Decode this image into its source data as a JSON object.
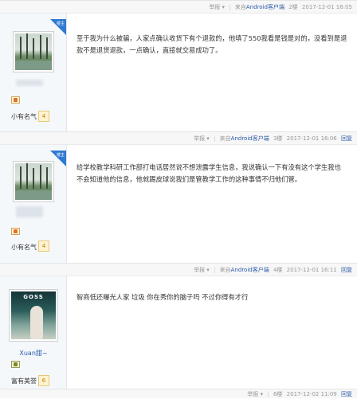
{
  "posts": [
    {
      "meta": {
        "report": "举报",
        "client_prefix": "来自",
        "client_link": "Android客户端",
        "floor": "2楼",
        "time": "2017-12-01 16:05",
        "reply": ""
      },
      "username": "",
      "level_label": "小有名气",
      "level": "4",
      "corner_text": "楼主",
      "avatar": "tree-photo",
      "content": "至于我为什么被骗，人家点确认收货下有个退款的，他填了550我看是钱是对的，没看到是退款不是退货退款，一点确认，直接就交易成功了。"
    },
    {
      "meta": {
        "report": "举报",
        "client_prefix": "来自",
        "client_link": "Android客户端",
        "floor": "3楼",
        "time": "2017-12-01 16:06",
        "reply": "回复"
      },
      "username": "",
      "level_label": "小有名气",
      "level": "4",
      "corner_text": "楼主",
      "avatar": "tree-photo",
      "content": "给学校教学科研工作部打电话居然说不想泄露学生信息，我说确认一下有没有这个学生我也不会知道他的信息，他就踢皮球说我们是管教学工作的这种事情不归他们管。"
    },
    {
      "meta": {
        "report": "举报",
        "client_prefix": "来自",
        "client_link": "Android客户端",
        "floor": "4楼",
        "time": "2017-12-01 16:11",
        "reply": "回复"
      },
      "username": "Xuan甜~",
      "level_label": "富有美誉",
      "level": "6",
      "corner_text": "",
      "avatar": "person-photo",
      "avatar_title": "GOSS",
      "content": "智商低还曝光人家 垃圾 你在秀你的脑子吗 不过你得有才行"
    },
    {
      "meta": {
        "report": "举报",
        "client_prefix": "",
        "client_link": "",
        "floor": "6楼",
        "time": "2017-12-02 11:09",
        "reply": "回复"
      }
    }
  ]
}
